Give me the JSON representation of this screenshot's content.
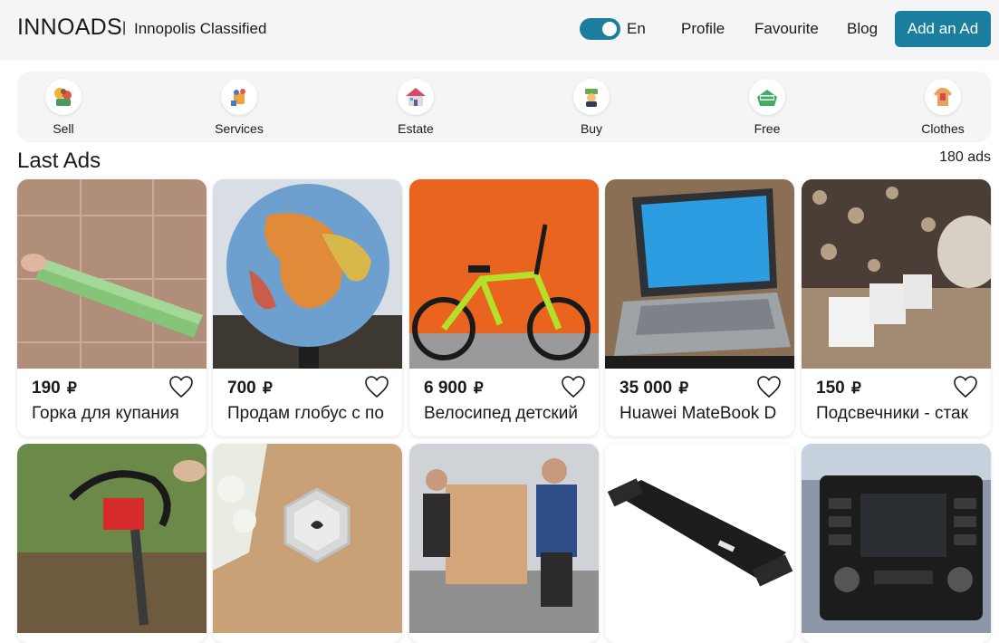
{
  "header": {
    "logo": "INNOADS",
    "separator": "|",
    "subtitle": "Innopolis Classified",
    "language": "En",
    "nav": [
      "Profile",
      "Favourite",
      "Blog"
    ],
    "add_button": "Add an Ad",
    "accent_color": "#1b7e9e"
  },
  "categories": [
    {
      "label": "Sell",
      "icon": "sell-icon"
    },
    {
      "label": "Services",
      "icon": "services-icon"
    },
    {
      "label": "Estate",
      "icon": "estate-icon"
    },
    {
      "label": "Buy",
      "icon": "buy-icon"
    },
    {
      "label": "Free",
      "icon": "free-icon"
    },
    {
      "label": "Clothes",
      "icon": "clothes-icon"
    }
  ],
  "section": {
    "title": "Last Ads",
    "count": "180 ads"
  },
  "ads": [
    {
      "price": "190",
      "currency": "₽",
      "title": "Горка для купания"
    },
    {
      "price": "700",
      "currency": "₽",
      "title": "Продам глобус с по"
    },
    {
      "price": "6 900",
      "currency": "₽",
      "title": "Велосипед детский"
    },
    {
      "price": "35 000",
      "currency": "₽",
      "title": "Huawei MateBook D"
    },
    {
      "price": "150",
      "currency": "₽",
      "title": "Подсвечники - стак"
    }
  ]
}
